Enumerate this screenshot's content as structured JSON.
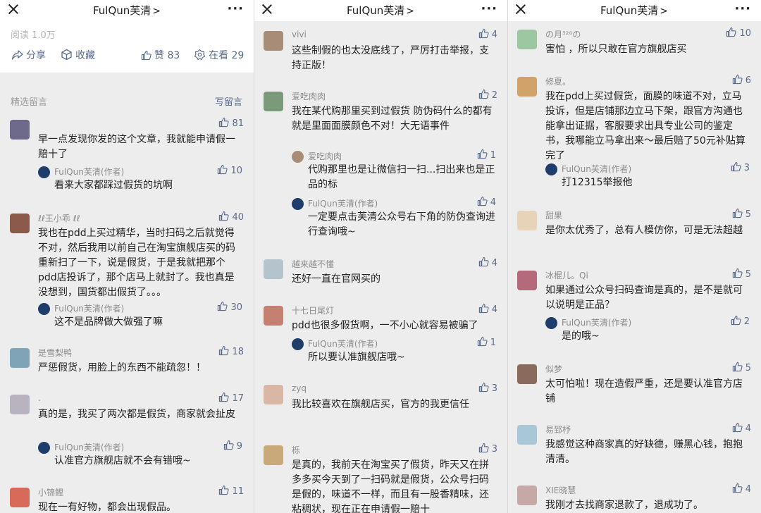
{
  "panels": [
    {
      "title": "FulQun芙清",
      "title_chevron": ">",
      "reads": "阅读 1.0万",
      "actions": {
        "share": "分享",
        "collect": "收藏",
        "like": "赞 83",
        "watch": "在看 29"
      },
      "section_title": "精选留言",
      "write_button": "写留言",
      "comments": [
        {
          "nick": "",
          "likes": "81",
          "text": "早一点发现你发的这个文章，我就能申请假一赔十了"
        },
        {
          "reply_nick": "FulQun芙清(作者)",
          "reply_likes": "10",
          "reply_text": "看来大家都踩过假货的坑啊"
        },
        {
          "nick": "ℓℓ王小乖 ℓℓ",
          "likes": "40",
          "text": "我也在pdd上买过精华，当时扫码之后就觉得不对，然后我用以前自己在淘宝旗舰店买的码重新扫了一下，说是假货，于是我就把那个pdd店投诉了，那个店马上就封了。我也真是没想到，国货都出假货了。。。"
        },
        {
          "reply_nick": "FulQun芙清(作者)",
          "reply_likes": "30",
          "reply_text": "这不是品牌做大做强了嘛"
        },
        {
          "nick": "是雪梨鸭",
          "likes": "18",
          "text": " 严惩假货，用脸上的东西不能疏忽！！"
        },
        {
          "nick": ".",
          "likes": "17",
          "text": "真的是，我买了两次都是假货，商家就会扯皮"
        },
        {
          "reply_nick": "FulQun芙清(作者)",
          "reply_likes": "9",
          "reply_text": "认准官方旗舰店就不会有错哦~"
        },
        {
          "nick": "小锦鲤",
          "likes": "11",
          "text": "现在一有好物，都会出现假品。"
        }
      ]
    },
    {
      "title": "FulQun芙清",
      "title_chevron": ">",
      "comments": [
        {
          "nick": "vivi",
          "likes": "4",
          "text": "这些制假的也太没底线了，严厉打击举报，支持正版！"
        },
        {
          "nick": "爱吃肉肉",
          "likes": "2",
          "text": "我在某代购那里买到过假货 防伪码什么的都有就是里面面膜颜色不对！大无语事件"
        },
        {
          "reply_nick": "爱吃肉肉",
          "reply_likes": "1",
          "reply_text": "代购那里也是让微信扫一扫...扫出来也是正品的标"
        },
        {
          "reply_nick": "FulQun芙清(作者)",
          "reply_likes": "4",
          "reply_text": "一定要点击芙清公众号右下角的防伪查询进行查询哦~"
        },
        {
          "nick": "越来越不懂",
          "likes": "4",
          "text": "还好一直在官网买的"
        },
        {
          "nick": "十七日尾灯",
          "likes": "4",
          "text": "pdd也很多假货啊，一不小心就容易被骗了"
        },
        {
          "reply_nick": "FulQun芙清(作者)",
          "reply_likes": "1",
          "reply_text": "所以要认准旗舰店哦~"
        },
        {
          "nick": "zyq",
          "likes": "3",
          "text": "我比较喜欢在旗舰店买，官方的我更信任"
        },
        {
          "nick": "栎",
          "likes": "3",
          "text": "是真的，我前天在淘宝买了假货，昨天又在拼多多买今天到了一扫码就是假货，公众号扫码是假的，味道不一样，而且有一股香精味，还粘稠状，现在正在申请假一赔十"
        }
      ]
    },
    {
      "title": "FulQun芙清",
      "title_chevron": ">",
      "comments": [
        {
          "nick": "の月⁵²⁰の",
          "likes": "10",
          "text": "害怕 ，所以只敢在官方旗舰店买"
        },
        {
          "nick": "修夏。",
          "likes": "6",
          "text": "我在pdd上买过假货，面膜的味道不对，立马投诉，但是店铺那边立马下架，跟官方沟通也能拿出证据，客服要求出具专业公司的鉴定书，我哪能立马拿出来～最后赔了50元补贴算完了"
        },
        {
          "reply_nick": "FulQun芙清(作者)",
          "reply_likes": "3",
          "reply_text": "打12315举报他"
        },
        {
          "nick": "甜果",
          "likes": "5",
          "text": "是你太优秀了，总有人模仿你，可是无法超越"
        },
        {
          "nick": "冰棍儿。Qi",
          "likes": "5",
          "text": "如果通过公众号扫码查询是真的，是不是就可以说明是正品？"
        },
        {
          "reply_nick": "FulQun芙清(作者)",
          "reply_likes": "2",
          "reply_text": "是的哦~"
        },
        {
          "nick": "似梦",
          "likes": "5",
          "text": "太可怕啦！现在造假严重，还是要认准官方店铺"
        },
        {
          "nick": "易郅杼",
          "likes": "4",
          "text": "我感觉这种商家真的好缺德，赚黑心钱，抱抱清清。"
        },
        {
          "nick": "XIE晓慧",
          "likes": "4",
          "text": "我刚才去找商家退款了，退成功了。"
        }
      ]
    }
  ]
}
